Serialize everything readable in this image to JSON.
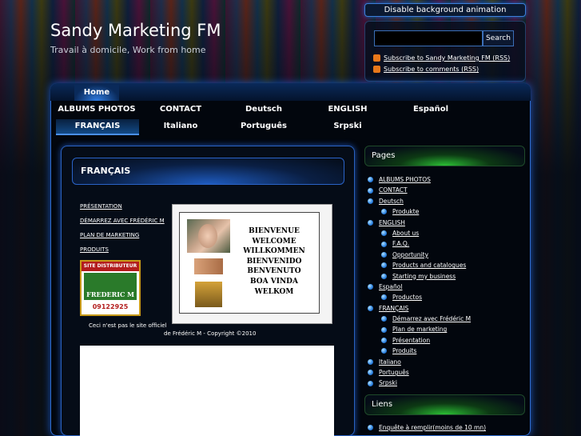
{
  "top": {
    "animation_toggle": "Disable background animation"
  },
  "site": {
    "title": "Sandy Marketing FM",
    "subtitle": "Travail à domicile, Work from home"
  },
  "search": {
    "button": "Search",
    "placeholder": ""
  },
  "feeds": [
    "Subscribe to Sandy Marketing FM (RSS)",
    "Subscribe to comments (RSS)"
  ],
  "nav": {
    "home": "Home",
    "row1": [
      "ALBUMS PHOTOS",
      "CONTACT",
      "Deutsch",
      "ENGLISH",
      "Español"
    ],
    "row2": [
      "FRANÇAIS",
      "Italiano",
      "Português",
      "Srpski"
    ]
  },
  "content": {
    "heading": "FRANÇAIS",
    "links": [
      "PRÉSENTATION",
      "DÉMARREZ AVEC FRÉDÉRIC M",
      "PLAN DE MARKETING",
      "PRODUITS"
    ],
    "welcome": [
      "BIENVENUE",
      "WELCOME",
      "WILLKOMMEN",
      "BIENVENIDO",
      "BENVENUTO",
      "BOA VINDA",
      "WELKOM"
    ],
    "badge": {
      "title": "SITE DISTRIBUTEUR",
      "brand": "FREDERIC M",
      "number": "09122925"
    },
    "notice_line1": "Ceci n'est pas le site officiel",
    "notice_line2": "de Frédéric M - Copyright ©2010"
  },
  "sidebar": {
    "pages_title": "Pages",
    "pages": [
      {
        "label": "ALBUMS PHOTOS",
        "level": 0
      },
      {
        "label": "CONTACT",
        "level": 0
      },
      {
        "label": "Deutsch",
        "level": 0
      },
      {
        "label": "Produkte",
        "level": 1
      },
      {
        "label": "ENGLISH",
        "level": 0
      },
      {
        "label": "About us",
        "level": 1
      },
      {
        "label": "F.A.Q.",
        "level": 1
      },
      {
        "label": "Opportunity",
        "level": 1
      },
      {
        "label": "Products and catalogues",
        "level": 1
      },
      {
        "label": "Starting my business",
        "level": 1
      },
      {
        "label": "Español",
        "level": 0
      },
      {
        "label": "Productos",
        "level": 1
      },
      {
        "label": "FRANÇAIS",
        "level": 0
      },
      {
        "label": "Démarrez avec Frédéric M",
        "level": 1
      },
      {
        "label": "Plan de marketing",
        "level": 1
      },
      {
        "label": "Présentation",
        "level": 1
      },
      {
        "label": "Produits",
        "level": 1
      },
      {
        "label": "Italiano",
        "level": 0
      },
      {
        "label": "Português",
        "level": 0
      },
      {
        "label": "Srpski",
        "level": 0
      }
    ],
    "links_title": "Liens",
    "links": [
      {
        "label": "Enquête à remplir",
        "suffix": " (moins de 10 mn)"
      }
    ]
  }
}
